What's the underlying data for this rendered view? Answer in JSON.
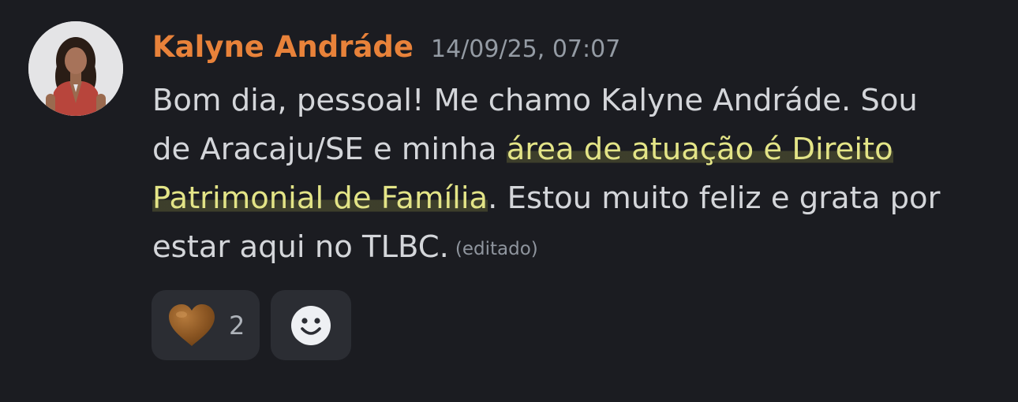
{
  "message": {
    "author": "Kalyne Andráde",
    "author_color": "#e8823a",
    "timestamp": "14/09/25, 07:07",
    "lines": [
      {
        "plain": "Bom dia, pessoal! Me chamo Kalyne Andráde. Sou",
        "highlight": "",
        "after": ""
      },
      {
        "plain": "de Aracaju/SE e minha ",
        "highlight": "área de atuação é Direito",
        "after": ""
      },
      {
        "plain": "",
        "highlight": "Patrimonial de Família",
        "after": ". Estou muito feliz e grata por"
      },
      {
        "plain": "estar aqui no TLBC.",
        "highlight": "",
        "after": ""
      }
    ],
    "edited_label": "(editado)",
    "reactions": [
      {
        "emoji": "brown-heart-icon",
        "count": "2"
      }
    ],
    "add_reaction_icon": "smiley-face-icon"
  },
  "colors": {
    "background": "#1b1c21",
    "highlight_text": "#e3e487",
    "reaction_bg": "#2b2d33"
  }
}
